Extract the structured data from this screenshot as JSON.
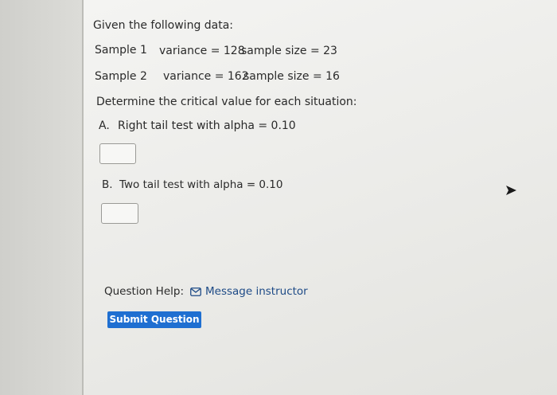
{
  "intro": "Given the following data:",
  "samples": [
    {
      "name": "Sample 1",
      "variance": "variance = 128",
      "size": "sample size = 23"
    },
    {
      "name": "Sample 2",
      "variance": "variance = 162",
      "size": "sample size = 16"
    }
  ],
  "prompt": "Determine the critical value for each situation:",
  "parts": [
    {
      "label": "A.",
      "text": "Right tail test with alpha = 0.10",
      "answer": ""
    },
    {
      "label": "B.",
      "text": "Two tail test with alpha = 0.10",
      "answer": ""
    }
  ],
  "help": {
    "label": "Question Help:",
    "link": "Message instructor",
    "icon": "envelope-icon"
  },
  "submit_label": "Submit Question",
  "colors": {
    "button": "#1f6fd1",
    "link": "#1d4a86"
  }
}
